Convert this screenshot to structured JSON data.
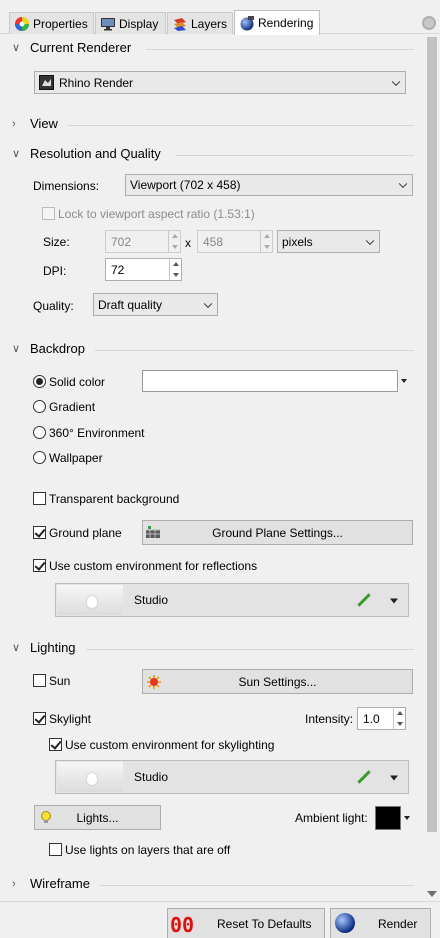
{
  "tabs": [
    {
      "label": "Properties",
      "icon": "color-wheel-icon"
    },
    {
      "label": "Display",
      "icon": "monitor-icon"
    },
    {
      "label": "Layers",
      "icon": "layers-icon"
    },
    {
      "label": "Rendering",
      "icon": "rendering-sphere-icon",
      "active": true
    }
  ],
  "current_renderer": {
    "title": "Current Renderer",
    "value": "Rhino Render"
  },
  "view": {
    "title": "View"
  },
  "resolution": {
    "title": "Resolution and Quality",
    "dimensions_label": "Dimensions:",
    "dimensions_value": "Viewport (702 x 458)",
    "lock_aspect_label": "Lock to viewport aspect ratio (1.53:1)",
    "size_label": "Size:",
    "width": "702",
    "x_label": "x",
    "height": "458",
    "units": "pixels",
    "dpi_label": "DPI:",
    "dpi": "72",
    "quality_label": "Quality:",
    "quality_value": "Draft quality"
  },
  "backdrop": {
    "title": "Backdrop",
    "options": [
      "Solid color",
      "Gradient",
      "360° Environment",
      "Wallpaper"
    ],
    "selected": "Solid color",
    "solid_color_hex": "#ffffff",
    "transparent_bg_label": "Transparent background",
    "ground_plane_label": "Ground plane",
    "ground_plane_settings": "Ground Plane Settings...",
    "custom_env_reflections_label": "Use custom environment for reflections",
    "reflection_env_name": "Studio"
  },
  "lighting": {
    "title": "Lighting",
    "sun_label": "Sun",
    "sun_settings": "Sun Settings...",
    "skylight_label": "Skylight",
    "intensity_label": "Intensity:",
    "intensity": "1.0",
    "custom_env_skylight_label": "Use custom environment for skylighting",
    "skylight_env_name": "Studio",
    "lights_button": "Lights...",
    "ambient_label": "Ambient light:",
    "ambient_color_hex": "#000000",
    "lights_on_off_layers_label": "Use lights on layers that are off"
  },
  "wireframe": {
    "title": "Wireframe"
  },
  "footer": {
    "reset_label": "Reset To Defaults",
    "render_label": "Render"
  }
}
